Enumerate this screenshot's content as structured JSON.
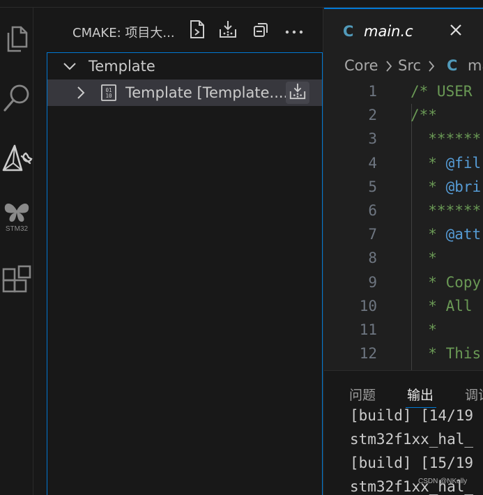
{
  "activity_bar": {
    "items": [
      {
        "icon": "files-icon"
      },
      {
        "icon": "search-icon"
      },
      {
        "icon": "cmake-icon"
      },
      {
        "icon": "stm32-butterfly-icon",
        "label": "STM32"
      },
      {
        "icon": "extensions-icon"
      }
    ]
  },
  "sidebar": {
    "title": "CMAKE: 项目大...",
    "actions": [
      "configure-file-icon",
      "build-icon",
      "collapse-all-icon",
      "more-icon"
    ],
    "tree": {
      "root_label": "Template",
      "child_label": "Template [Template...."
    }
  },
  "editor": {
    "tab": {
      "lang_badge": "C",
      "filename": "main.c"
    },
    "breadcrumbs": {
      "part1": "Core",
      "part2": "Src",
      "file_badge": "C",
      "file": "ma"
    },
    "lines": [
      {
        "n": "1",
        "text": "/* USER"
      },
      {
        "n": "2",
        "text": "/**"
      },
      {
        "n": "3",
        "text": "  ******"
      },
      {
        "n": "4",
        "text": "  * ",
        "kw": "@fil"
      },
      {
        "n": "5",
        "text": "  * ",
        "kw": "@bri"
      },
      {
        "n": "6",
        "text": "  ******"
      },
      {
        "n": "7",
        "text": "  * ",
        "kw": "@att"
      },
      {
        "n": "8",
        "text": "  *"
      },
      {
        "n": "9",
        "text": "  * Copy"
      },
      {
        "n": "10",
        "text": "  * All"
      },
      {
        "n": "11",
        "text": "  *"
      },
      {
        "n": "12",
        "text": "  * This"
      }
    ]
  },
  "panel": {
    "tabs": [
      "问题",
      "输出",
      "调试"
    ],
    "active_tab": "输出",
    "output_lines": [
      "[build] [14/19",
      "stm32f1xx_hal_",
      "[build] [15/19",
      "stm32f1xx_hal_"
    ],
    "watermark": "CSDN @NKelly"
  },
  "colors": {
    "accent": "#0078d4",
    "comment": "#6a9955",
    "keyword": "#569cd6",
    "c_badge": "#519aba"
  }
}
